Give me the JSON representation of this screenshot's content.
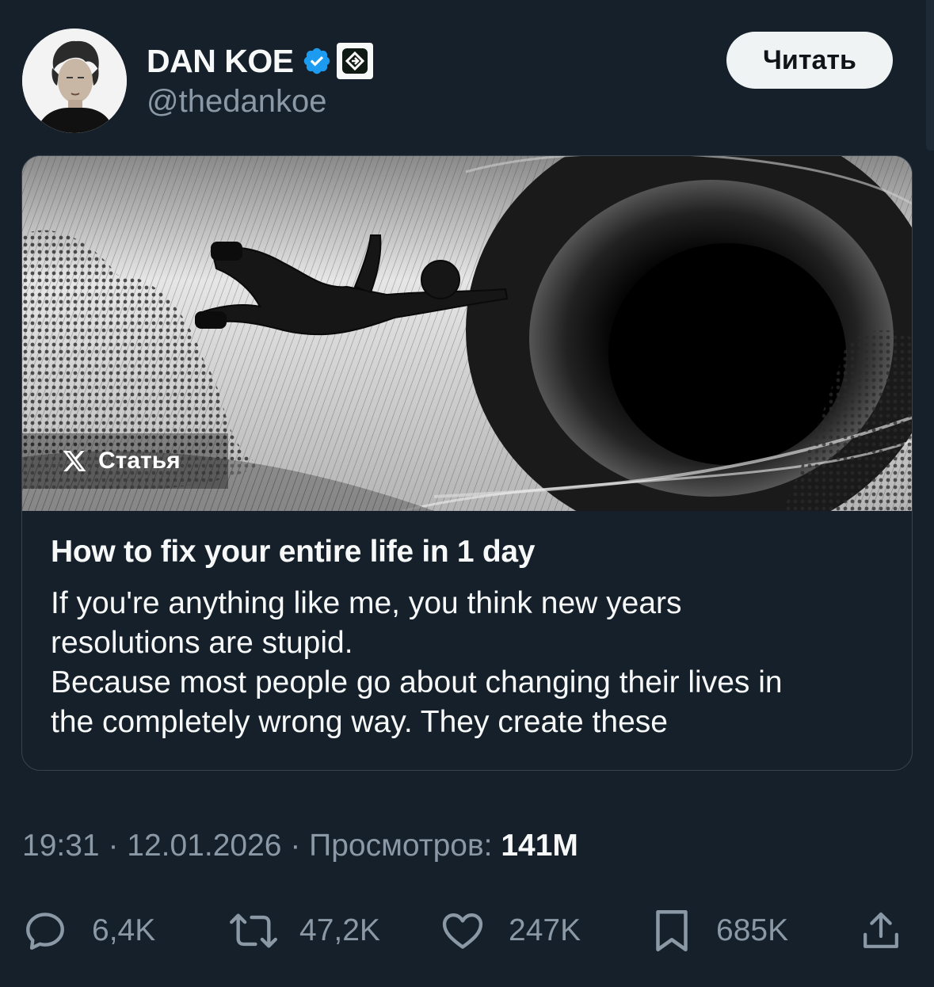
{
  "author": {
    "display_name": "DAN KOE",
    "handle": "@thedankoe",
    "verified_icon": "verified-badge-icon",
    "affiliate_icon": "affiliate-badge-icon"
  },
  "header": {
    "read_button_label": "Читать"
  },
  "article": {
    "label": "Статья",
    "title": "How to fix your entire life in 1 day",
    "excerpt_line1": "If you're anything like me, you think new years",
    "excerpt_line2": "resolutions are stupid.",
    "excerpt_line3": "Because most people go about changing their lives in",
    "excerpt_line4": "the completely wrong way. They create these"
  },
  "meta": {
    "time": "19:31",
    "separator": " · ",
    "date": "12.01.2026",
    "views_label": "Просмотров:",
    "views_count": "141M"
  },
  "actions": {
    "replies": "6,4K",
    "reposts": "47,2K",
    "likes": "247K",
    "bookmarks": "685K"
  },
  "colors": {
    "background": "#15202b",
    "text_primary": "#f7f9f9",
    "text_secondary": "#8b98a5",
    "verified_blue": "#1d9bf0",
    "border": "#38444d"
  }
}
